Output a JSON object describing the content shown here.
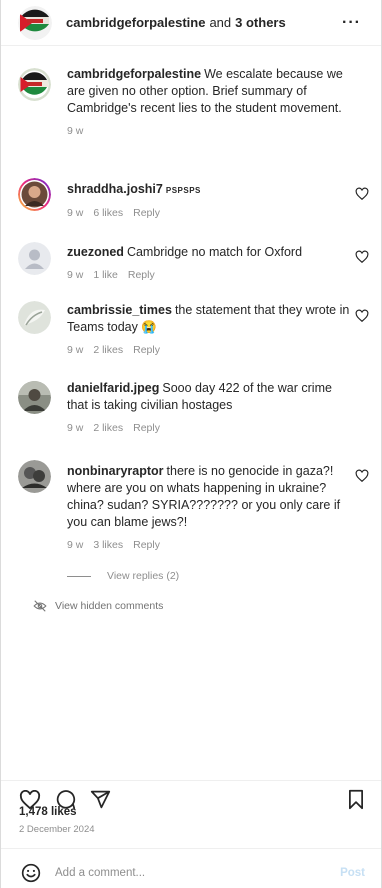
{
  "header": {
    "username": "cambridgeforpalestine",
    "and_label": "and",
    "others_label": "3 others",
    "more_label": "···"
  },
  "caption": {
    "username": "cambridgeforpalestine",
    "text": "We escalate because we are given no other option. Brief summary of Cambridge's recent lies to the student movement.",
    "time": "9 w"
  },
  "comments": [
    {
      "username": "shraddha.joshi7",
      "text": "PSPSPS",
      "time": "9 w",
      "likes": "6 likes",
      "reply": "Reply"
    },
    {
      "username": "zuezoned",
      "text": "Cambridge no match for Oxford",
      "time": "9 w",
      "likes": "1 like",
      "reply": "Reply"
    },
    {
      "username": "cambrissie_times",
      "text": "the statement that they wrote in Teams today 😭",
      "time": "9 w",
      "likes": "2 likes",
      "reply": "Reply"
    },
    {
      "username": "danielfarid.jpeg",
      "text": "Sooo day 422 of the war crime that is taking civilian hostages",
      "time": "9 w",
      "likes": "2 likes",
      "reply": "Reply"
    },
    {
      "username": "nonbinaryraptor",
      "text": "there is no genocide in gaza?! where are you on whats happening in ukraine? china? sudan? SYRIA??????? or you only care if you can blame jews?!",
      "time": "9 w",
      "likes": "3 likes",
      "reply": "Reply"
    }
  ],
  "view_replies": "View replies (2)",
  "hidden_comments": "View hidden comments",
  "actions": {
    "like_icon": "heart-icon",
    "comment_icon": "comment-icon",
    "share_icon": "share-icon",
    "save_icon": "bookmark-icon"
  },
  "likes_count": "1,478 likes",
  "date": "2 December 2024",
  "add_comment": {
    "placeholder": "Add a comment...",
    "post_label": "Post"
  },
  "colors": {
    "text": "#262626",
    "muted": "#8e8e8e",
    "post": "#c7e0f4"
  }
}
